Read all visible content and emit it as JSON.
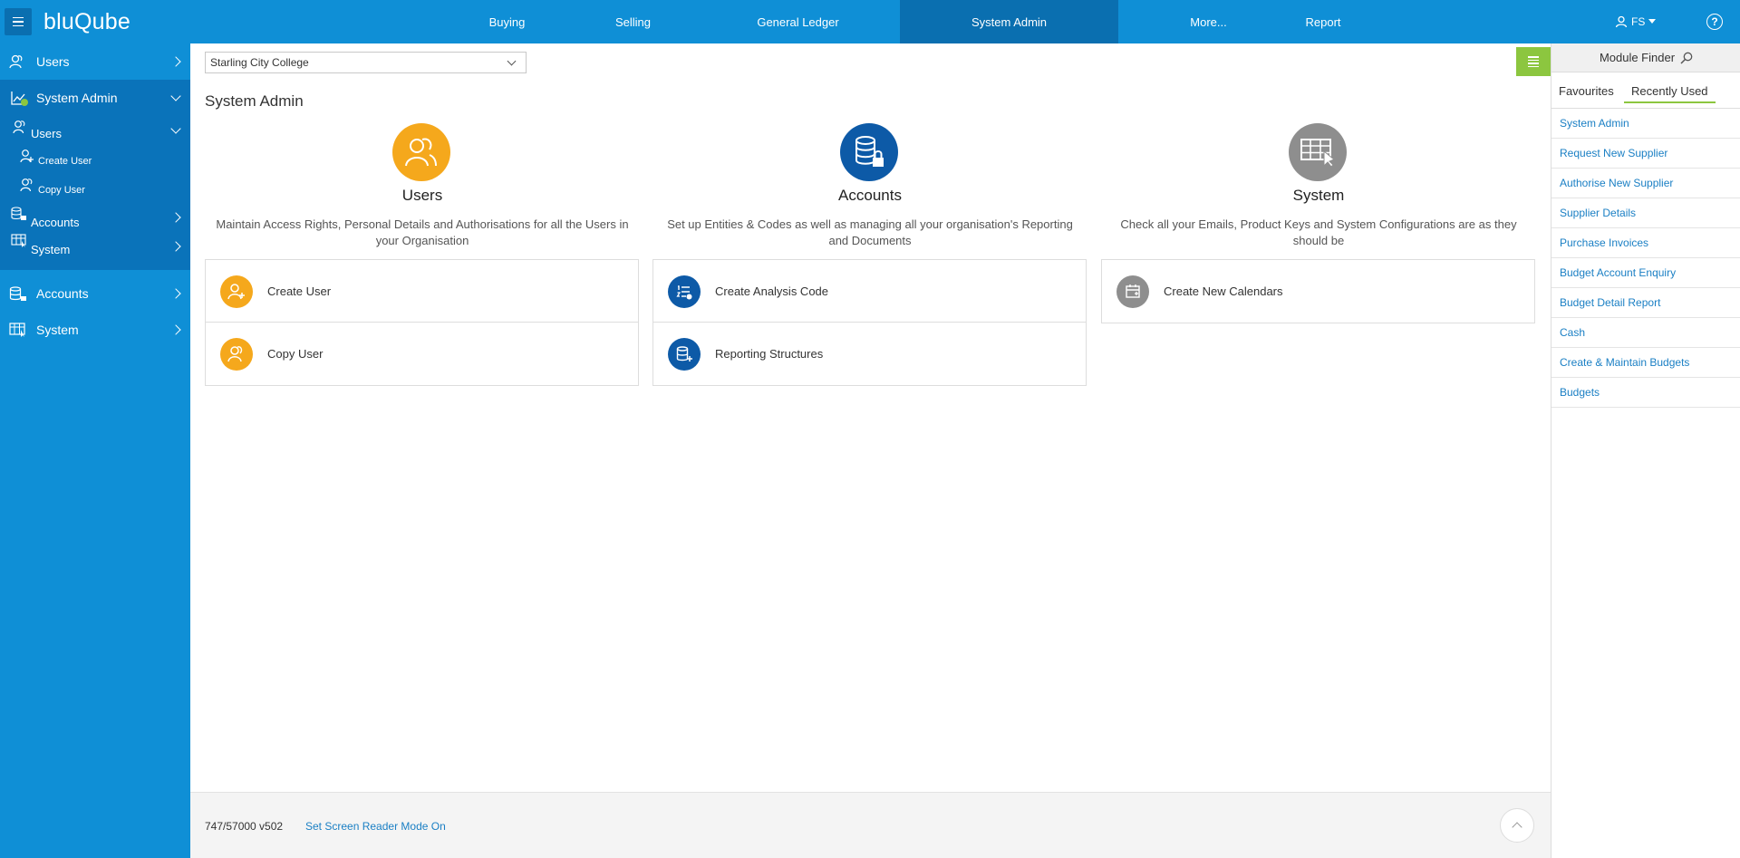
{
  "app": {
    "name": "bluQube"
  },
  "topnav": {
    "items": [
      {
        "label": "Buying"
      },
      {
        "label": "Selling"
      },
      {
        "label": "General Ledger"
      },
      {
        "label": "System Admin"
      },
      {
        "label": "More..."
      },
      {
        "label": "Report"
      }
    ],
    "active": "System Admin",
    "user_initials": "FS"
  },
  "sidebar": {
    "users": "Users",
    "system_admin": "System Admin",
    "sub_users": "Users",
    "create_user": "Create User",
    "copy_user": "Copy User",
    "sub_accounts": "Accounts",
    "sub_system": "System",
    "accounts": "Accounts",
    "system": "System"
  },
  "main": {
    "organisation": "Starling City College",
    "page_title": "System Admin",
    "columns": [
      {
        "title": "Users",
        "description": "Maintain Access Rights, Personal Details and Authorisations for all the Users in your Organisation",
        "items": [
          "Create User",
          "Copy User"
        ],
        "color": "#f5a81c"
      },
      {
        "title": "Accounts",
        "description": "Set up Entities & Codes as well as managing all your organisation's Reporting and Documents",
        "items": [
          "Create Analysis Code",
          "Reporting Structures"
        ],
        "color": "#0d5aa7"
      },
      {
        "title": "System",
        "description": "Check all your Emails, Product Keys and System Configurations are as they should be",
        "items": [
          "Create New Calendars"
        ],
        "color": "#8e8e8e"
      }
    ]
  },
  "footer": {
    "version": "747/57000 v502",
    "screen_reader_link": "Set Screen Reader Mode On"
  },
  "module_finder": {
    "title": "Module Finder",
    "tabs": [
      "Favourites",
      "Recently Used"
    ],
    "active_tab": "Recently Used",
    "items": [
      "System Admin",
      "Request New Supplier",
      "Authorise New Supplier",
      "Supplier Details",
      "Purchase Invoices",
      "Budget Account Enquiry",
      "Budget Detail Report",
      "Cash",
      "Create & Maintain Budgets",
      "Budgets"
    ]
  },
  "colors": {
    "brand_blue": "#0f8fd6",
    "active_nav": "#0a6fb0",
    "accent_green": "#8cc63f",
    "link_blue": "#1a7fc4"
  }
}
